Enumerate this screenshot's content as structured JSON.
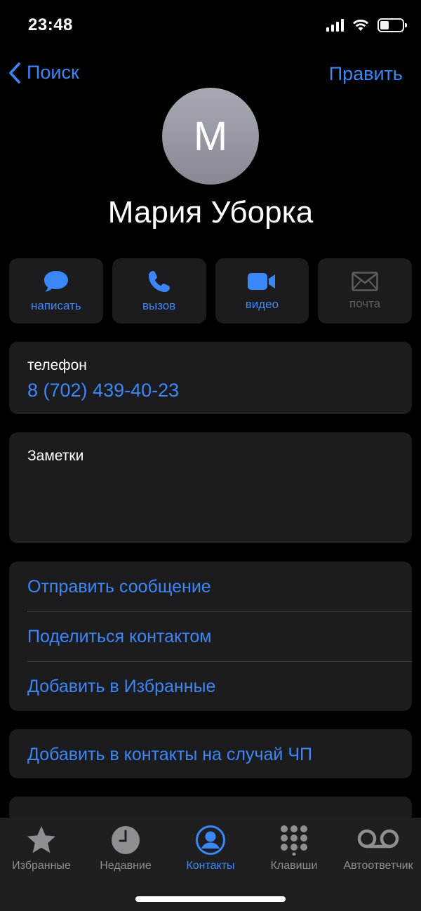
{
  "status": {
    "time": "23:48"
  },
  "nav": {
    "back_label": "Поиск",
    "edit_label": "Править"
  },
  "contact": {
    "initial": "М",
    "name": "Мария Уборка"
  },
  "actions": [
    {
      "label": "написать",
      "icon": "message-bubble-icon"
    },
    {
      "label": "вызов",
      "icon": "phone-icon"
    },
    {
      "label": "видео",
      "icon": "video-camera-icon"
    },
    {
      "label": "почта",
      "icon": "mail-envelope-icon"
    }
  ],
  "phone": {
    "label": "телефон",
    "number": "8 (702) 439-40-23"
  },
  "notes": {
    "label": "Заметки"
  },
  "options": [
    "Отправить сообщение",
    "Поделиться контактом",
    "Добавить в Избранные"
  ],
  "emergency": {
    "label": "Добавить в контакты на случай ЧП"
  },
  "tabs": [
    {
      "label": "Избранные",
      "icon": "star-icon"
    },
    {
      "label": "Недавние",
      "icon": "clock-icon"
    },
    {
      "label": "Контакты",
      "icon": "person-circle-icon",
      "active": true
    },
    {
      "label": "Клавиши",
      "icon": "keypad-icon"
    },
    {
      "label": "Автоответчик",
      "icon": "voicemail-icon"
    }
  ],
  "colors": {
    "accent": "#3b87f7",
    "card": "#1c1c1e",
    "background": "#000000",
    "inactive": "#8e8e93"
  }
}
